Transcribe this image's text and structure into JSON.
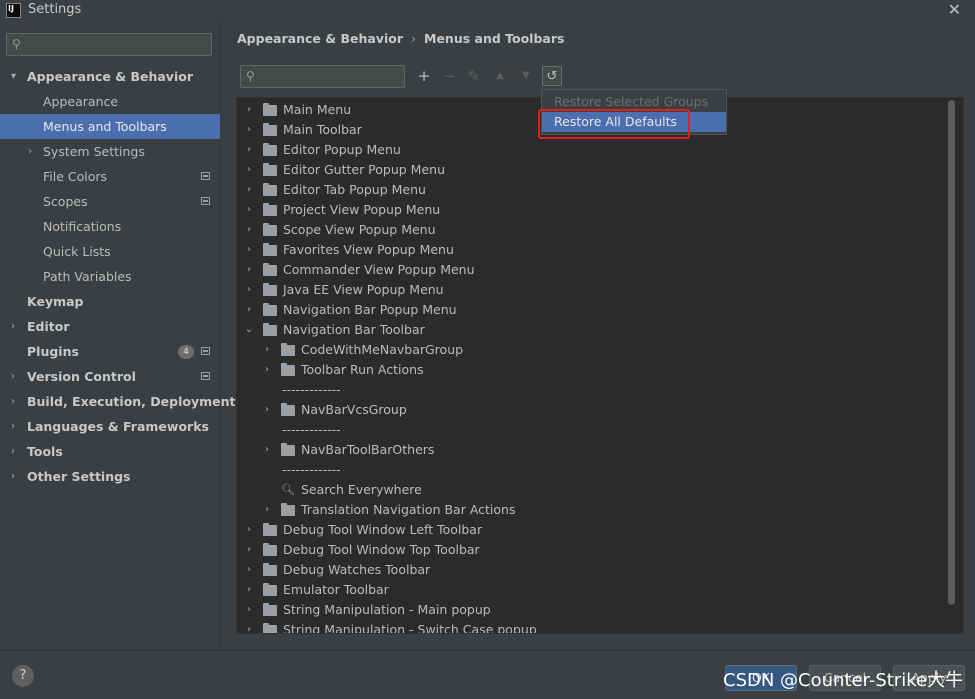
{
  "window": {
    "title": "Settings",
    "close_icon": "close-icon"
  },
  "sidebar": {
    "search_placeholder": "",
    "items": [
      {
        "label": "Appearance & Behavior",
        "level": 0,
        "bold": true,
        "expander": "▾",
        "selected": false
      },
      {
        "label": "Appearance",
        "level": 1,
        "bold": false,
        "expander": "",
        "selected": false
      },
      {
        "label": "Menus and Toolbars",
        "level": 1,
        "bold": false,
        "expander": "",
        "selected": true
      },
      {
        "label": "System Settings",
        "level": 1,
        "bold": false,
        "expander": "›",
        "selected": false
      },
      {
        "label": "File Colors",
        "level": 1,
        "bold": false,
        "expander": "",
        "selected": false,
        "icon": true
      },
      {
        "label": "Scopes",
        "level": 1,
        "bold": false,
        "expander": "",
        "selected": false,
        "icon": true
      },
      {
        "label": "Notifications",
        "level": 1,
        "bold": false,
        "expander": "",
        "selected": false
      },
      {
        "label": "Quick Lists",
        "level": 1,
        "bold": false,
        "expander": "",
        "selected": false
      },
      {
        "label": "Path Variables",
        "level": 1,
        "bold": false,
        "expander": "",
        "selected": false
      },
      {
        "label": "Keymap",
        "level": 0,
        "bold": true,
        "expander": "",
        "selected": false
      },
      {
        "label": "Editor",
        "level": 0,
        "bold": true,
        "expander": "›",
        "selected": false
      },
      {
        "label": "Plugins",
        "level": 0,
        "bold": true,
        "expander": "",
        "selected": false,
        "badge": "4",
        "icon": true
      },
      {
        "label": "Version Control",
        "level": 0,
        "bold": true,
        "expander": "›",
        "selected": false,
        "icon": true
      },
      {
        "label": "Build, Execution, Deployment",
        "level": 0,
        "bold": true,
        "expander": "›",
        "selected": false
      },
      {
        "label": "Languages & Frameworks",
        "level": 0,
        "bold": true,
        "expander": "›",
        "selected": false
      },
      {
        "label": "Tools",
        "level": 0,
        "bold": true,
        "expander": "›",
        "selected": false
      },
      {
        "label": "Other Settings",
        "level": 0,
        "bold": true,
        "expander": "›",
        "selected": false
      }
    ]
  },
  "breadcrumb": {
    "parent": "Appearance & Behavior",
    "separator": "›",
    "current": "Menus and Toolbars"
  },
  "toolbar": {
    "search_placeholder": "",
    "buttons": [
      {
        "name": "add-button",
        "glyph": "+",
        "disabled": false
      },
      {
        "name": "remove-button",
        "glyph": "−",
        "disabled": true
      },
      {
        "name": "edit-button",
        "glyph": "✎",
        "disabled": true
      },
      {
        "name": "move-up-button",
        "glyph": "▲",
        "disabled": true
      },
      {
        "name": "move-down-button",
        "glyph": "▼",
        "disabled": true
      },
      {
        "name": "restore-defaults-button",
        "glyph": "↺",
        "disabled": false
      }
    ]
  },
  "tree": [
    {
      "label": "Main Menu",
      "depth": 0,
      "type": "folder",
      "chev": "›"
    },
    {
      "label": "Main Toolbar",
      "depth": 0,
      "type": "folder",
      "chev": "›"
    },
    {
      "label": "Editor Popup Menu",
      "depth": 0,
      "type": "folder",
      "chev": "›"
    },
    {
      "label": "Editor Gutter Popup Menu",
      "depth": 0,
      "type": "folder",
      "chev": "›"
    },
    {
      "label": "Editor Tab Popup Menu",
      "depth": 0,
      "type": "folder",
      "chev": "›"
    },
    {
      "label": "Project View Popup Menu",
      "depth": 0,
      "type": "folder",
      "chev": "›"
    },
    {
      "label": "Scope View Popup Menu",
      "depth": 0,
      "type": "folder",
      "chev": "›"
    },
    {
      "label": "Favorites View Popup Menu",
      "depth": 0,
      "type": "folder",
      "chev": "›"
    },
    {
      "label": "Commander View Popup Menu",
      "depth": 0,
      "type": "folder",
      "chev": "›"
    },
    {
      "label": "Java EE View Popup Menu",
      "depth": 0,
      "type": "folder",
      "chev": "›"
    },
    {
      "label": "Navigation Bar Popup Menu",
      "depth": 0,
      "type": "folder",
      "chev": "›"
    },
    {
      "label": "Navigation Bar Toolbar",
      "depth": 0,
      "type": "folder",
      "chev": "⌄"
    },
    {
      "label": "CodeWithMeNavbarGroup",
      "depth": 1,
      "type": "folder",
      "chev": "›"
    },
    {
      "label": "Toolbar Run Actions",
      "depth": 1,
      "type": "folder",
      "chev": "›"
    },
    {
      "label": "-------------",
      "depth": 1,
      "type": "separator",
      "chev": ""
    },
    {
      "label": "NavBarVcsGroup",
      "depth": 1,
      "type": "folder",
      "chev": "›"
    },
    {
      "label": "-------------",
      "depth": 1,
      "type": "separator",
      "chev": ""
    },
    {
      "label": "NavBarToolBarOthers",
      "depth": 1,
      "type": "folder",
      "chev": "›"
    },
    {
      "label": "-------------",
      "depth": 1,
      "type": "separator",
      "chev": ""
    },
    {
      "label": "Search Everywhere",
      "depth": 1,
      "type": "search",
      "chev": ""
    },
    {
      "label": "Translation Navigation Bar Actions",
      "depth": 1,
      "type": "folder",
      "chev": "›"
    },
    {
      "label": "Debug Tool Window Left Toolbar",
      "depth": 0,
      "type": "folder",
      "chev": "›"
    },
    {
      "label": "Debug Tool Window Top Toolbar",
      "depth": 0,
      "type": "folder",
      "chev": "›"
    },
    {
      "label": "Debug Watches Toolbar",
      "depth": 0,
      "type": "folder",
      "chev": "›"
    },
    {
      "label": "Emulator Toolbar",
      "depth": 0,
      "type": "folder",
      "chev": "›"
    },
    {
      "label": "String Manipulation - Main popup",
      "depth": 0,
      "type": "folder",
      "chev": "›"
    },
    {
      "label": "String Manipulation - Switch Case popup",
      "depth": 0,
      "type": "folder",
      "chev": "›"
    }
  ],
  "restore_menu": {
    "items": [
      {
        "label": "Restore Selected Groups",
        "disabled": true
      },
      {
        "label": "Restore All Defaults",
        "disabled": false,
        "highlighted": true
      }
    ]
  },
  "footer": {
    "help": "?",
    "ok": "OK",
    "cancel": "Cancel",
    "apply": "Apply"
  },
  "watermark": "CSDN @Counter-Strike大牛",
  "colors": {
    "accent": "#4b6eaf",
    "highlight_box": "#e0201c",
    "background": "#3c3f41",
    "tree_bg": "#2b2b2b"
  }
}
